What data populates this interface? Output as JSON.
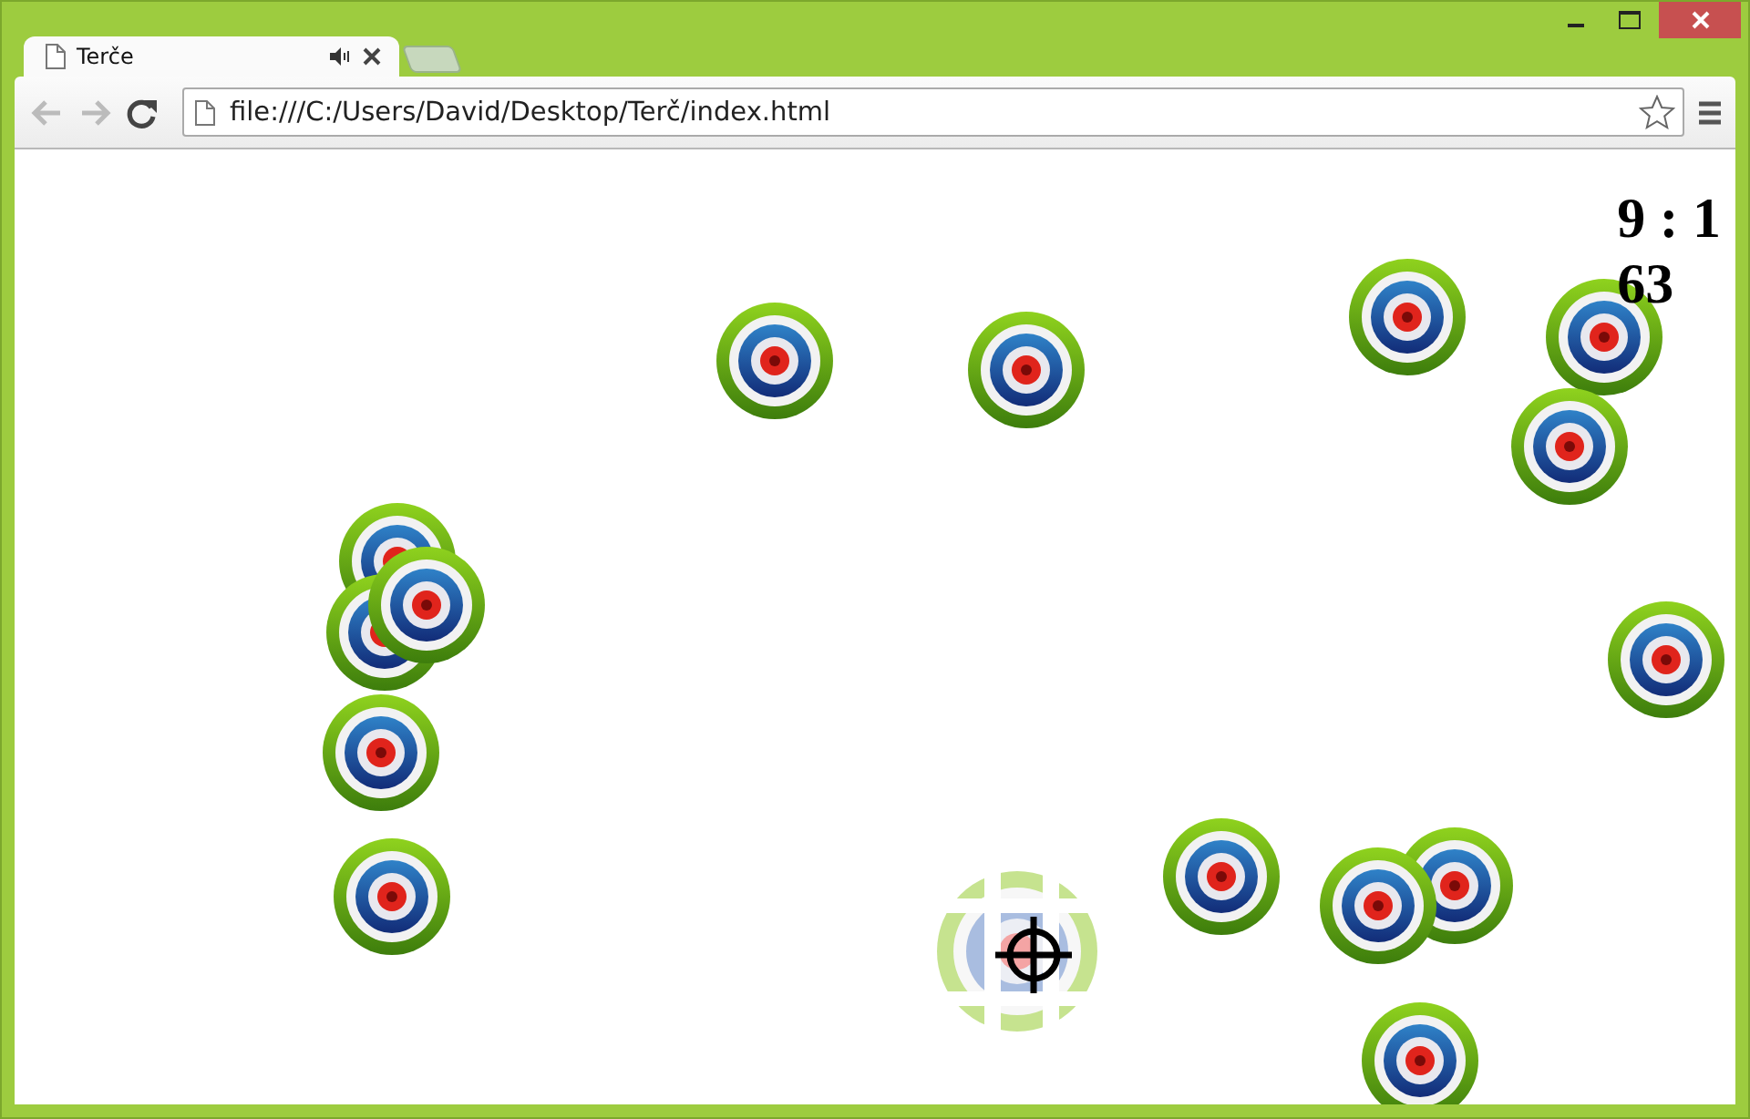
{
  "window": {
    "tabs": [
      {
        "label": "Terče",
        "selected": true
      }
    ],
    "address": "file:///C:/Users/David/Desktop/Terč/index.html"
  },
  "game": {
    "score": "9 : 1",
    "time": "63"
  }
}
